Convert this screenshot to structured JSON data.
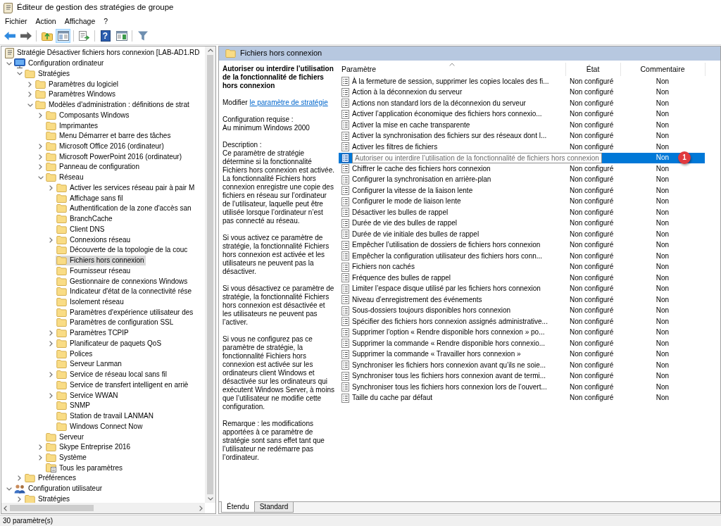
{
  "window": {
    "title": "Éditeur de gestion des stratégies de groupe"
  },
  "menu": [
    {
      "label": "Fichier"
    },
    {
      "label": "Action"
    },
    {
      "label": "Affichage"
    },
    {
      "label": "?"
    }
  ],
  "toolbar": [
    [
      {
        "kind": "back",
        "disabled": false,
        "pressed": false
      },
      {
        "kind": "forward",
        "disabled": true,
        "pressed": false
      }
    ],
    [
      {
        "kind": "up-folder",
        "disabled": false,
        "pressed": false
      },
      {
        "kind": "console-tree",
        "disabled": false,
        "pressed": true
      }
    ],
    [
      {
        "kind": "export",
        "disabled": false,
        "pressed": false
      }
    ],
    [
      {
        "kind": "help",
        "glyph": "?",
        "disabled": false,
        "pressed": false
      },
      {
        "kind": "action-pane",
        "disabled": false,
        "pressed": false
      }
    ],
    [
      {
        "kind": "filter",
        "disabled": false,
        "pressed": false
      }
    ]
  ],
  "tree": [
    {
      "label": "Stratégie Désactiver fichiers hors connexion [LAB-AD1.RD",
      "kind": "policy",
      "selected": false,
      "children": [
        {
          "label": "Configuration ordinateur",
          "kind": "computer",
          "expanded": true,
          "selected": false,
          "children": [
            {
              "label": "Stratégies",
              "kind": "folder",
              "expanded": true,
              "selected": false,
              "children": [
                {
                  "label": "Paramètres du logiciel",
                  "kind": "folder",
                  "expanded": false,
                  "selected": false
                },
                {
                  "label": "Paramètres Windows",
                  "kind": "folder",
                  "expanded": false,
                  "selected": false
                },
                {
                  "label": "Modèles d'administration : définitions de strat",
                  "kind": "folder",
                  "expanded": true,
                  "selected": false,
                  "children": [
                    {
                      "label": "Composants Windows",
                      "kind": "folder",
                      "expanded": false,
                      "selected": false
                    },
                    {
                      "label": "Imprimantes",
                      "kind": "folder",
                      "selected": false
                    },
                    {
                      "label": "Menu Démarrer et barre des tâches",
                      "kind": "folder",
                      "selected": false
                    },
                    {
                      "label": "Microsoft Office 2016 (ordinateur)",
                      "kind": "folder",
                      "expanded": false,
                      "selected": false
                    },
                    {
                      "label": "Microsoft PowerPoint 2016 (ordinateur)",
                      "kind": "folder",
                      "expanded": false,
                      "selected": false
                    },
                    {
                      "label": "Panneau de configuration",
                      "kind": "folder",
                      "expanded": false,
                      "selected": false
                    },
                    {
                      "label": "Réseau",
                      "kind": "folder",
                      "expanded": true,
                      "selected": false,
                      "children": [
                        {
                          "label": "Activer les services réseau pair à pair M",
                          "kind": "folder",
                          "expanded": false,
                          "selected": false
                        },
                        {
                          "label": "Affichage sans fil",
                          "kind": "folder",
                          "selected": false
                        },
                        {
                          "label": "Authentification de la zone d'accès san",
                          "kind": "folder",
                          "selected": false
                        },
                        {
                          "label": "BranchCache",
                          "kind": "folder",
                          "selected": false
                        },
                        {
                          "label": "Client DNS",
                          "kind": "folder",
                          "selected": false
                        },
                        {
                          "label": "Connexions réseau",
                          "kind": "folder",
                          "expanded": false,
                          "selected": false
                        },
                        {
                          "label": "Découverte de la topologie de la couc",
                          "kind": "folder",
                          "selected": false
                        },
                        {
                          "label": "Fichiers hors connexion",
                          "kind": "folder",
                          "selected": true
                        },
                        {
                          "label": "Fournisseur réseau",
                          "kind": "folder",
                          "selected": false
                        },
                        {
                          "label": "Gestionnaire de connexions Windows",
                          "kind": "folder",
                          "selected": false
                        },
                        {
                          "label": "Indicateur d'état de la connectivité rése",
                          "kind": "folder",
                          "selected": false
                        },
                        {
                          "label": "Isolement réseau",
                          "kind": "folder",
                          "selected": false
                        },
                        {
                          "label": "Paramètres d'expérience utilisateur des",
                          "kind": "folder",
                          "selected": false
                        },
                        {
                          "label": "Paramètres de configuration SSL",
                          "kind": "folder",
                          "selected": false
                        },
                        {
                          "label": "Paramètres TCPIP",
                          "kind": "folder",
                          "expanded": false,
                          "selected": false
                        },
                        {
                          "label": "Planificateur de paquets QoS",
                          "kind": "folder",
                          "expanded": false,
                          "selected": false
                        },
                        {
                          "label": "Polices",
                          "kind": "folder",
                          "selected": false
                        },
                        {
                          "label": "Serveur Lanman",
                          "kind": "folder",
                          "selected": false
                        },
                        {
                          "label": "Service de réseau local sans fil",
                          "kind": "folder",
                          "expanded": false,
                          "selected": false
                        },
                        {
                          "label": "Service de transfert intelligent en arriè",
                          "kind": "folder",
                          "selected": false
                        },
                        {
                          "label": "Service WWAN",
                          "kind": "folder",
                          "expanded": false,
                          "selected": false
                        },
                        {
                          "label": "SNMP",
                          "kind": "folder",
                          "selected": false
                        },
                        {
                          "label": "Station de travail LANMAN",
                          "kind": "folder",
                          "selected": false
                        },
                        {
                          "label": "Windows Connect Now",
                          "kind": "folder",
                          "selected": false
                        }
                      ]
                    },
                    {
                      "label": "Serveur",
                      "kind": "folder",
                      "selected": false
                    },
                    {
                      "label": "Skype Entreprise 2016",
                      "kind": "folder",
                      "expanded": false,
                      "selected": false
                    },
                    {
                      "label": "Système",
                      "kind": "folder",
                      "expanded": false,
                      "selected": false
                    },
                    {
                      "label": "Tous les paramètres",
                      "kind": "all-settings",
                      "selected": false
                    }
                  ]
                }
              ]
            },
            {
              "label": "Préférences",
              "kind": "folder",
              "expanded": false,
              "selected": false
            }
          ]
        },
        {
          "label": "Configuration utilisateur",
          "kind": "users",
          "expanded": true,
          "selected": false,
          "children": [
            {
              "label": "Stratégies",
              "kind": "folder",
              "expanded": false,
              "selected": false
            }
          ]
        }
      ]
    }
  ],
  "details": {
    "header": "Fichiers hors connexion",
    "title": "Autoriser ou interdire l’utilisation de la fonctionnalité de fichiers hors connexion",
    "edit_prefix": "Modifier",
    "edit_link": "le paramètre de stratégie",
    "requirement_label": "Configuration requise :",
    "requirement_value": "Au minimum Windows 2000",
    "description_label": "Description :",
    "paragraphs": [
      "Ce paramètre de stratégie détermine si la fonctionnalité Fichiers hors connexion est activée. La fonctionnalité Fichiers hors connexion enregistre une copie des fichiers en réseau sur l’ordinateur de l’utilisateur, laquelle peut être utilisée lorsque l’ordinateur n’est pas connecté au réseau.",
      "Si vous activez ce paramètre de stratégie, la fonctionnalité Fichiers hors connexion est activée et les utilisateurs ne peuvent pas la désactiver.",
      "Si vous désactivez ce paramètre de stratégie, la fonctionnalité Fichiers hors connexion est désactivée et les utilisateurs ne peuvent pas l’activer.",
      "Si vous ne configurez pas ce paramètre de stratégie, la fonctionnalité Fichiers hors connexion est activée sur les ordinateurs client Windows et désactivée sur les ordinateurs qui exécutent Windows Server, à moins que l’utilisateur ne modifie cette configuration.",
      "Remarque : les modifications apportées à ce paramètre de stratégie sont sans effet tant que l’utilisateur ne redémarre pas l’ordinateur."
    ]
  },
  "table": {
    "columns": [
      {
        "label": "Paramètre",
        "sorted": true
      },
      {
        "label": "État",
        "sorted": false
      },
      {
        "label": "Commentaire",
        "sorted": false
      }
    ],
    "rows": [
      {
        "name": "À la fermeture de session, supprimer les copies locales des fi...",
        "state": "Non configuré",
        "comment": "Non",
        "selected": false
      },
      {
        "name": "Action à la déconnexion du serveur",
        "state": "Non configuré",
        "comment": "Non",
        "selected": false
      },
      {
        "name": "Actions non standard lors de la déconnexion du serveur",
        "state": "Non configuré",
        "comment": "Non",
        "selected": false
      },
      {
        "name": "Activer l’application économique des fichiers hors connexio...",
        "state": "Non configuré",
        "comment": "Non",
        "selected": false
      },
      {
        "name": "Activer la mise en cache transparente",
        "state": "Non configuré",
        "comment": "Non",
        "selected": false
      },
      {
        "name": "Activer la synchronisation des fichiers sur des réseaux dont l...",
        "state": "Non configuré",
        "comment": "Non",
        "selected": false
      },
      {
        "name": "Activer les filtres de fichiers",
        "state": "Non configuré",
        "comment": "Non",
        "selected": false
      },
      {
        "name": "Autoriser ou interdire l’utilisation de la fonctionnalité de fichiers hors connexion",
        "comment": "Non",
        "selected": true,
        "callout": "1"
      },
      {
        "name": "Chiffrer le cache des fichiers hors connexion",
        "state": "Non configuré",
        "comment": "Non",
        "selected": false
      },
      {
        "name": "Configurer la synchronisation en arrière-plan",
        "state": "Non configuré",
        "comment": "Non",
        "selected": false
      },
      {
        "name": "Configurer la vitesse de la liaison lente",
        "state": "Non configuré",
        "comment": "Non",
        "selected": false
      },
      {
        "name": "Configurer le mode de liaison lente",
        "state": "Non configuré",
        "comment": "Non",
        "selected": false
      },
      {
        "name": "Désactiver les bulles de rappel",
        "state": "Non configuré",
        "comment": "Non",
        "selected": false
      },
      {
        "name": "Durée de vie des bulles de rappel",
        "state": "Non configuré",
        "comment": "Non",
        "selected": false
      },
      {
        "name": "Durée de vie initiale des bulles de rappel",
        "state": "Non configuré",
        "comment": "Non",
        "selected": false
      },
      {
        "name": "Empêcher l’utilisation de dossiers de fichiers hors connexion",
        "state": "Non configuré",
        "comment": "Non",
        "selected": false
      },
      {
        "name": "Empêcher la configuration utilisateur des fichiers hors conn...",
        "state": "Non configuré",
        "comment": "Non",
        "selected": false
      },
      {
        "name": "Fichiers non cachés",
        "state": "Non configuré",
        "comment": "Non",
        "selected": false
      },
      {
        "name": "Fréquence des bulles de rappel",
        "state": "Non configuré",
        "comment": "Non",
        "selected": false
      },
      {
        "name": "Limiter l’espace disque utilisé par les fichiers hors connexion",
        "state": "Non configuré",
        "comment": "Non",
        "selected": false
      },
      {
        "name": "Niveau d’enregistrement des événements",
        "state": "Non configuré",
        "comment": "Non",
        "selected": false
      },
      {
        "name": "Sous-dossiers toujours disponibles hors connexion",
        "state": "Non configuré",
        "comment": "Non",
        "selected": false
      },
      {
        "name": "Spécifier des fichiers hors connexion assignés administrative...",
        "state": "Non configuré",
        "comment": "Non",
        "selected": false
      },
      {
        "name": "Supprimer l’option « Rendre disponible hors connexion » po...",
        "state": "Non configuré",
        "comment": "Non",
        "selected": false
      },
      {
        "name": "Supprimer la commande « Rendre disponible hors connexio...",
        "state": "Non configuré",
        "comment": "Non",
        "selected": false
      },
      {
        "name": "Supprimer la commande « Travailler hors connexion »",
        "state": "Non configuré",
        "comment": "Non",
        "selected": false
      },
      {
        "name": "Synchroniser les fichiers hors connexion avant qu’ils ne soie...",
        "state": "Non configuré",
        "comment": "Non",
        "selected": false
      },
      {
        "name": "Synchroniser tous les fichiers hors connexion avant de termi...",
        "state": "Non configuré",
        "comment": "Non",
        "selected": false
      },
      {
        "name": "Synchroniser tous les fichiers hors connexion lors de l’ouvert...",
        "state": "Non configuré",
        "comment": "Non",
        "selected": false
      },
      {
        "name": "Taille du cache par défaut",
        "state": "Non configuré",
        "comment": "Non",
        "selected": false
      }
    ]
  },
  "bottom_tabs": [
    {
      "label": "Étendu",
      "selected": true
    },
    {
      "label": "Standard",
      "selected": false
    }
  ],
  "status_bar": {
    "text": "30 paramètre(s)"
  }
}
